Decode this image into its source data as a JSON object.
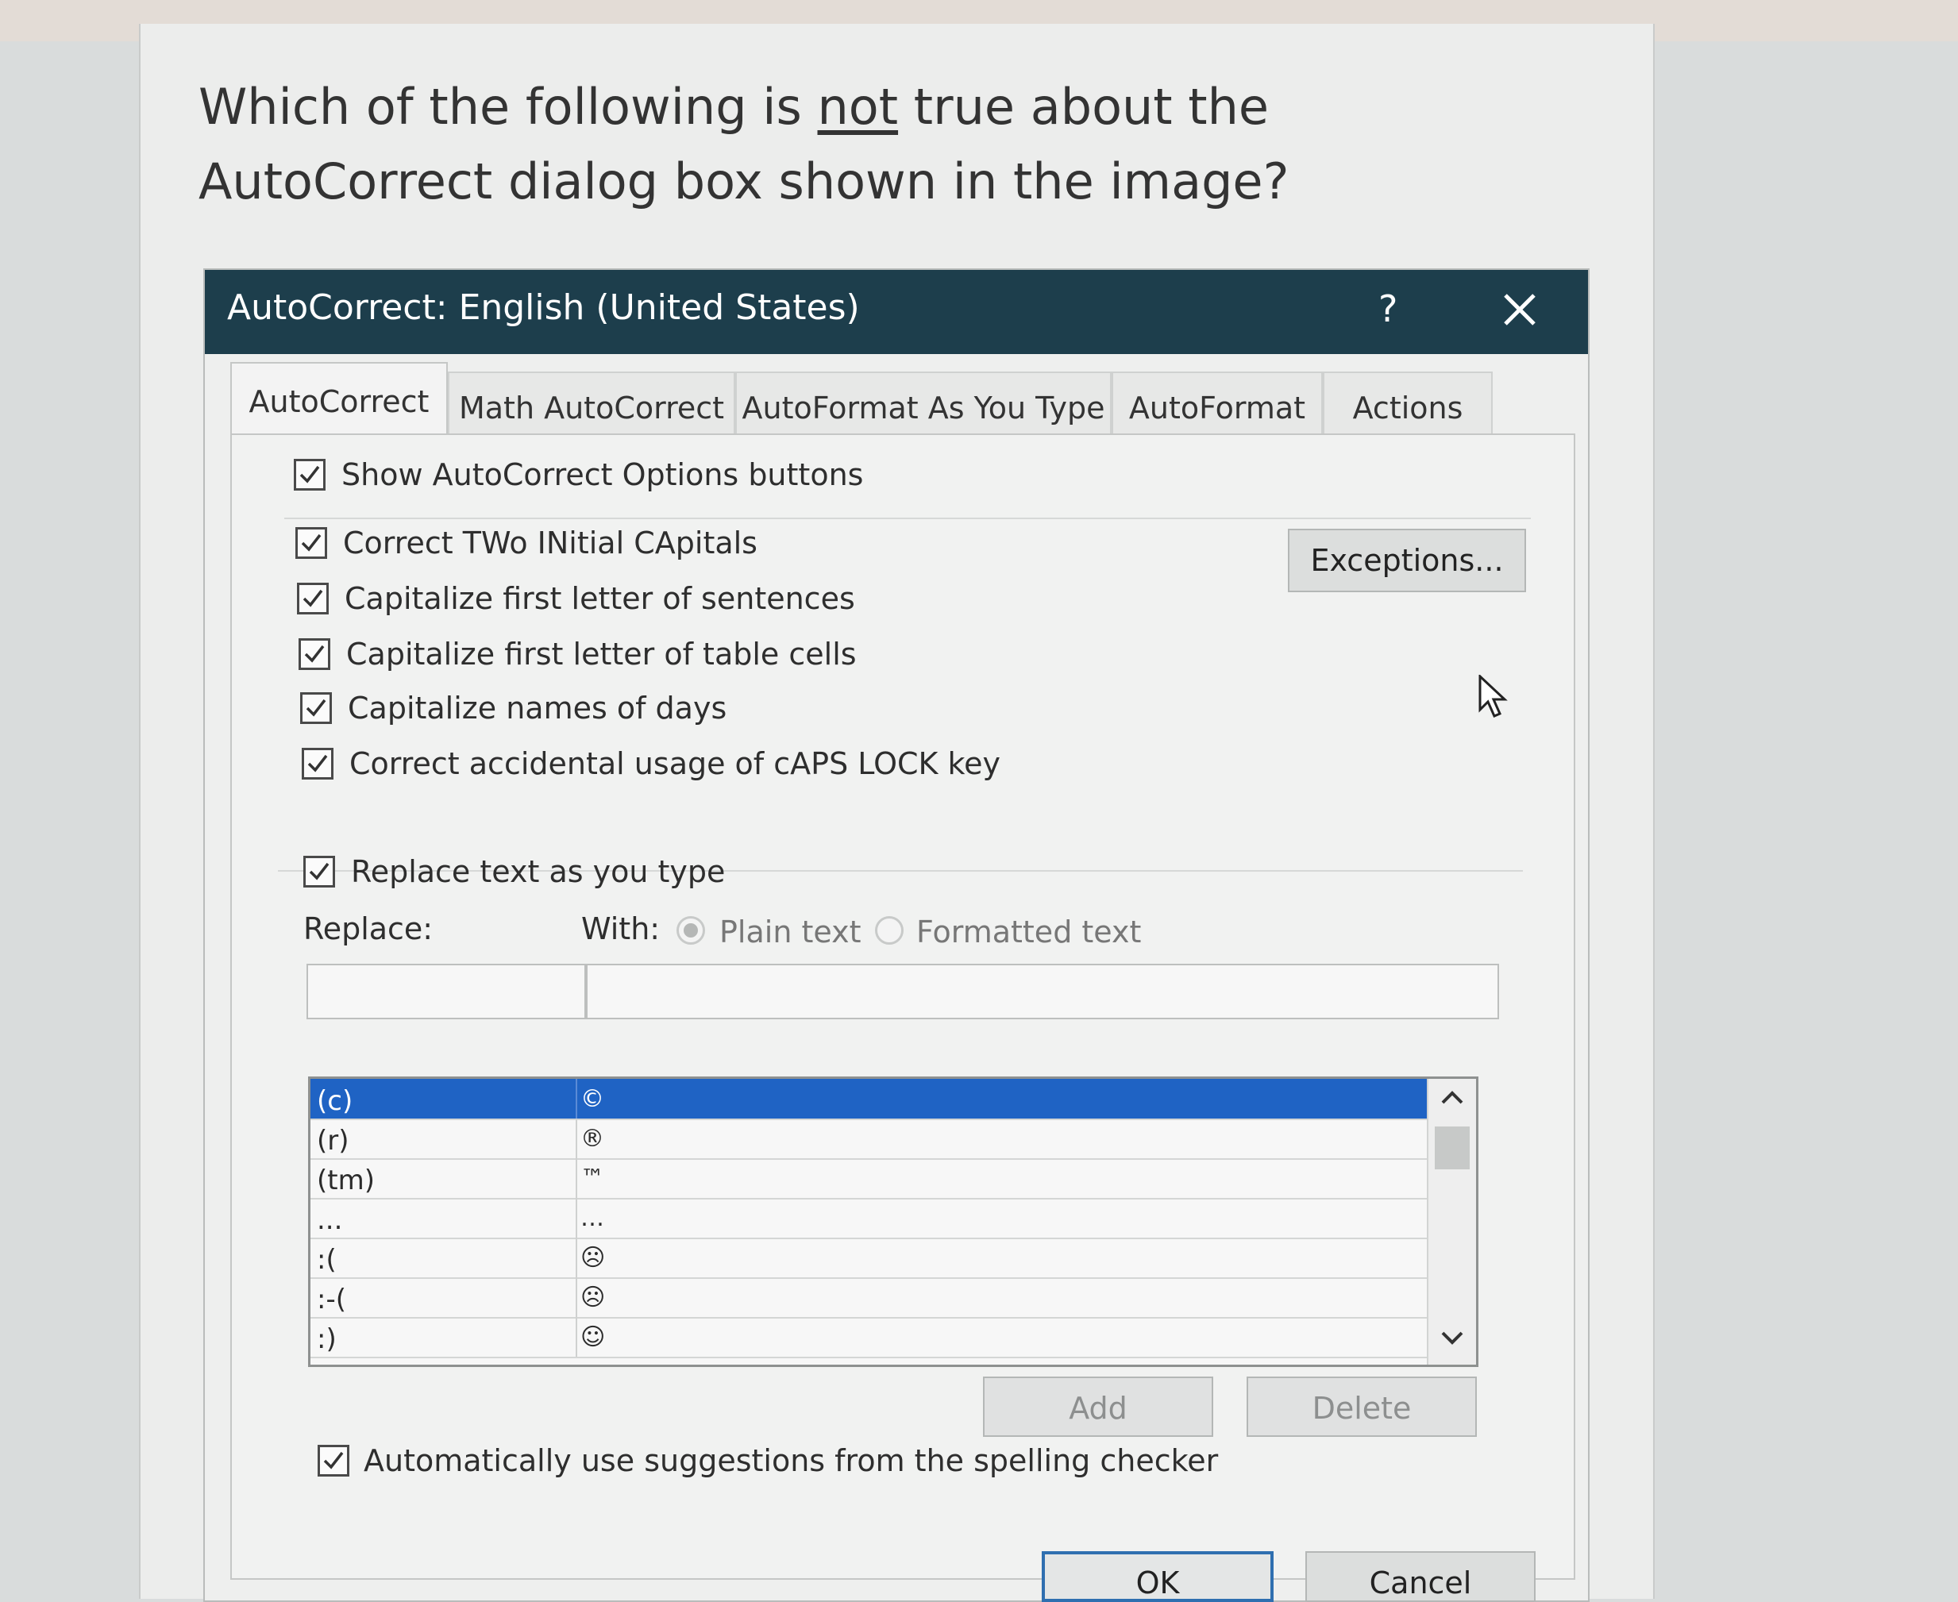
{
  "question": {
    "before": "Which of the following is ",
    "emphasis": "not",
    "after": " true about the AutoCorrect dialog box shown in the image?"
  },
  "dialog": {
    "title": "AutoCorrect: English (United States)",
    "help": "?",
    "tabs": [
      "AutoCorrect",
      "Math AutoCorrect",
      "AutoFormat As You Type",
      "AutoFormat",
      "Actions"
    ],
    "active_tab": "AutoCorrect",
    "show_options": {
      "label": "Show AutoCorrect Options buttons",
      "checked": true
    },
    "options": [
      {
        "label": "Correct TWo INitial CApitals",
        "checked": true
      },
      {
        "label": "Capitalize first letter of sentences",
        "checked": true
      },
      {
        "label": "Capitalize first letter of table cells",
        "checked": true
      },
      {
        "label": "Capitalize names of days",
        "checked": true
      },
      {
        "label": "Correct accidental usage of cAPS LOCK key",
        "checked": true
      }
    ],
    "exceptions_button": "Exceptions...",
    "replace_text": {
      "label": "Replace text as you type",
      "checked": true
    },
    "replace_label": "Replace:",
    "with_label": "With:",
    "radio_plain": {
      "label": "Plain text",
      "selected": true
    },
    "radio_formatted": {
      "label": "Formatted text",
      "selected": false
    },
    "replace_value": "",
    "with_value": "",
    "entries": [
      {
        "replace": "(c)",
        "with": "©",
        "selected": true
      },
      {
        "replace": "(r)",
        "with": "®"
      },
      {
        "replace": "(tm)",
        "with": "™"
      },
      {
        "replace": "...",
        "with": "…"
      },
      {
        "replace": ":(",
        "with": "☹"
      },
      {
        "replace": ":-(",
        "with": "☹"
      },
      {
        "replace": ":)",
        "with": "☺"
      }
    ],
    "add_button": "Add",
    "delete_button": "Delete",
    "spelling": {
      "label": "Automatically use suggestions from the spelling checker",
      "checked": true
    },
    "ok_button": "OK",
    "cancel_button": "Cancel"
  },
  "colors": {
    "titlebar": "#1d3e4c",
    "selection": "#1f63c4"
  }
}
